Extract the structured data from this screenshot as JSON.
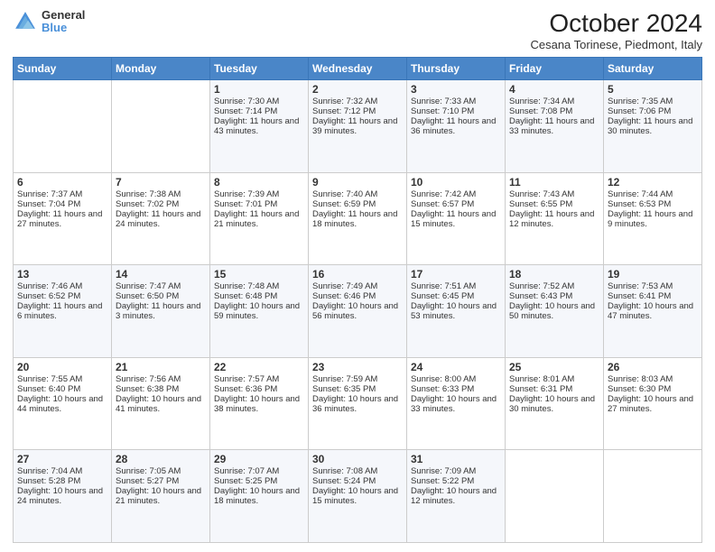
{
  "header": {
    "logo_line1": "General",
    "logo_line2": "Blue",
    "title": "October 2024",
    "subtitle": "Cesana Torinese, Piedmont, Italy"
  },
  "days_of_week": [
    "Sunday",
    "Monday",
    "Tuesday",
    "Wednesday",
    "Thursday",
    "Friday",
    "Saturday"
  ],
  "weeks": [
    [
      {
        "day": "",
        "sunrise": "",
        "sunset": "",
        "daylight": ""
      },
      {
        "day": "",
        "sunrise": "",
        "sunset": "",
        "daylight": ""
      },
      {
        "day": "1",
        "sunrise": "Sunrise: 7:30 AM",
        "sunset": "Sunset: 7:14 PM",
        "daylight": "Daylight: 11 hours and 43 minutes."
      },
      {
        "day": "2",
        "sunrise": "Sunrise: 7:32 AM",
        "sunset": "Sunset: 7:12 PM",
        "daylight": "Daylight: 11 hours and 39 minutes."
      },
      {
        "day": "3",
        "sunrise": "Sunrise: 7:33 AM",
        "sunset": "Sunset: 7:10 PM",
        "daylight": "Daylight: 11 hours and 36 minutes."
      },
      {
        "day": "4",
        "sunrise": "Sunrise: 7:34 AM",
        "sunset": "Sunset: 7:08 PM",
        "daylight": "Daylight: 11 hours and 33 minutes."
      },
      {
        "day": "5",
        "sunrise": "Sunrise: 7:35 AM",
        "sunset": "Sunset: 7:06 PM",
        "daylight": "Daylight: 11 hours and 30 minutes."
      }
    ],
    [
      {
        "day": "6",
        "sunrise": "Sunrise: 7:37 AM",
        "sunset": "Sunset: 7:04 PM",
        "daylight": "Daylight: 11 hours and 27 minutes."
      },
      {
        "day": "7",
        "sunrise": "Sunrise: 7:38 AM",
        "sunset": "Sunset: 7:02 PM",
        "daylight": "Daylight: 11 hours and 24 minutes."
      },
      {
        "day": "8",
        "sunrise": "Sunrise: 7:39 AM",
        "sunset": "Sunset: 7:01 PM",
        "daylight": "Daylight: 11 hours and 21 minutes."
      },
      {
        "day": "9",
        "sunrise": "Sunrise: 7:40 AM",
        "sunset": "Sunset: 6:59 PM",
        "daylight": "Daylight: 11 hours and 18 minutes."
      },
      {
        "day": "10",
        "sunrise": "Sunrise: 7:42 AM",
        "sunset": "Sunset: 6:57 PM",
        "daylight": "Daylight: 11 hours and 15 minutes."
      },
      {
        "day": "11",
        "sunrise": "Sunrise: 7:43 AM",
        "sunset": "Sunset: 6:55 PM",
        "daylight": "Daylight: 11 hours and 12 minutes."
      },
      {
        "day": "12",
        "sunrise": "Sunrise: 7:44 AM",
        "sunset": "Sunset: 6:53 PM",
        "daylight": "Daylight: 11 hours and 9 minutes."
      }
    ],
    [
      {
        "day": "13",
        "sunrise": "Sunrise: 7:46 AM",
        "sunset": "Sunset: 6:52 PM",
        "daylight": "Daylight: 11 hours and 6 minutes."
      },
      {
        "day": "14",
        "sunrise": "Sunrise: 7:47 AM",
        "sunset": "Sunset: 6:50 PM",
        "daylight": "Daylight: 11 hours and 3 minutes."
      },
      {
        "day": "15",
        "sunrise": "Sunrise: 7:48 AM",
        "sunset": "Sunset: 6:48 PM",
        "daylight": "Daylight: 10 hours and 59 minutes."
      },
      {
        "day": "16",
        "sunrise": "Sunrise: 7:49 AM",
        "sunset": "Sunset: 6:46 PM",
        "daylight": "Daylight: 10 hours and 56 minutes."
      },
      {
        "day": "17",
        "sunrise": "Sunrise: 7:51 AM",
        "sunset": "Sunset: 6:45 PM",
        "daylight": "Daylight: 10 hours and 53 minutes."
      },
      {
        "day": "18",
        "sunrise": "Sunrise: 7:52 AM",
        "sunset": "Sunset: 6:43 PM",
        "daylight": "Daylight: 10 hours and 50 minutes."
      },
      {
        "day": "19",
        "sunrise": "Sunrise: 7:53 AM",
        "sunset": "Sunset: 6:41 PM",
        "daylight": "Daylight: 10 hours and 47 minutes."
      }
    ],
    [
      {
        "day": "20",
        "sunrise": "Sunrise: 7:55 AM",
        "sunset": "Sunset: 6:40 PM",
        "daylight": "Daylight: 10 hours and 44 minutes."
      },
      {
        "day": "21",
        "sunrise": "Sunrise: 7:56 AM",
        "sunset": "Sunset: 6:38 PM",
        "daylight": "Daylight: 10 hours and 41 minutes."
      },
      {
        "day": "22",
        "sunrise": "Sunrise: 7:57 AM",
        "sunset": "Sunset: 6:36 PM",
        "daylight": "Daylight: 10 hours and 38 minutes."
      },
      {
        "day": "23",
        "sunrise": "Sunrise: 7:59 AM",
        "sunset": "Sunset: 6:35 PM",
        "daylight": "Daylight: 10 hours and 36 minutes."
      },
      {
        "day": "24",
        "sunrise": "Sunrise: 8:00 AM",
        "sunset": "Sunset: 6:33 PM",
        "daylight": "Daylight: 10 hours and 33 minutes."
      },
      {
        "day": "25",
        "sunrise": "Sunrise: 8:01 AM",
        "sunset": "Sunset: 6:31 PM",
        "daylight": "Daylight: 10 hours and 30 minutes."
      },
      {
        "day": "26",
        "sunrise": "Sunrise: 8:03 AM",
        "sunset": "Sunset: 6:30 PM",
        "daylight": "Daylight: 10 hours and 27 minutes."
      }
    ],
    [
      {
        "day": "27",
        "sunrise": "Sunrise: 7:04 AM",
        "sunset": "Sunset: 5:28 PM",
        "daylight": "Daylight: 10 hours and 24 minutes."
      },
      {
        "day": "28",
        "sunrise": "Sunrise: 7:05 AM",
        "sunset": "Sunset: 5:27 PM",
        "daylight": "Daylight: 10 hours and 21 minutes."
      },
      {
        "day": "29",
        "sunrise": "Sunrise: 7:07 AM",
        "sunset": "Sunset: 5:25 PM",
        "daylight": "Daylight: 10 hours and 18 minutes."
      },
      {
        "day": "30",
        "sunrise": "Sunrise: 7:08 AM",
        "sunset": "Sunset: 5:24 PM",
        "daylight": "Daylight: 10 hours and 15 minutes."
      },
      {
        "day": "31",
        "sunrise": "Sunrise: 7:09 AM",
        "sunset": "Sunset: 5:22 PM",
        "daylight": "Daylight: 10 hours and 12 minutes."
      },
      {
        "day": "",
        "sunrise": "",
        "sunset": "",
        "daylight": ""
      },
      {
        "day": "",
        "sunrise": "",
        "sunset": "",
        "daylight": ""
      }
    ]
  ]
}
